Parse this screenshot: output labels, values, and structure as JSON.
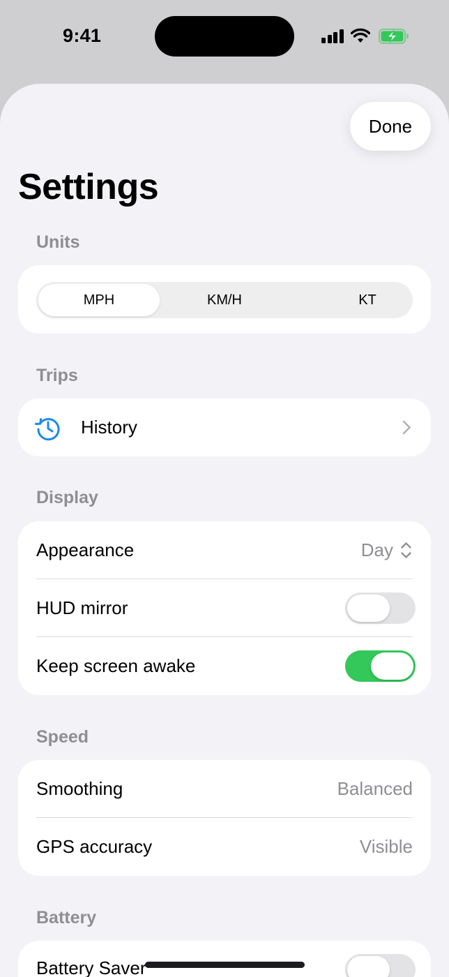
{
  "status_bar": {
    "time": "9:41",
    "battery_state": "charging",
    "accent": "#34c759"
  },
  "header": {
    "done_label": "Done",
    "title": "Settings"
  },
  "units": {
    "header": "Units",
    "options": [
      "MPH",
      "KM/H",
      "KT"
    ],
    "selected": "MPH"
  },
  "trips": {
    "header": "Trips",
    "history": {
      "label": "History",
      "icon": "history-clock-icon"
    }
  },
  "display": {
    "header": "Display",
    "appearance": {
      "label": "Appearance",
      "value": "Day"
    },
    "hud_mirror": {
      "label": "HUD mirror",
      "on": false
    },
    "keep_awake": {
      "label": "Keep screen awake",
      "on": true
    }
  },
  "speed": {
    "header": "Speed",
    "smoothing": {
      "label": "Smoothing",
      "value": "Balanced"
    },
    "gps_accuracy": {
      "label": "GPS accuracy",
      "value": "Visible"
    }
  },
  "battery": {
    "header": "Battery",
    "battery_saver": {
      "label": "Battery Saver",
      "on": false
    }
  },
  "colors": {
    "toggle_on": "#34c759",
    "link_blue": "#1a8ae8",
    "secondary_text": "#8e8e93"
  }
}
